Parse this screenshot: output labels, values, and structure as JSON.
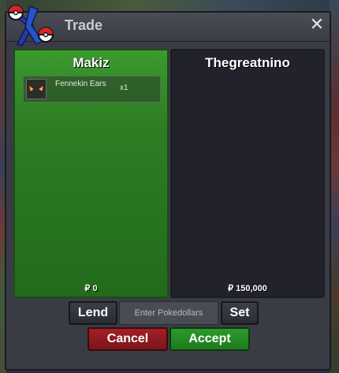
{
  "window": {
    "title": "Trade",
    "close_label": "✕"
  },
  "left_panel": {
    "player": "Makiz",
    "money": "₽ 0",
    "items": [
      {
        "name": "Fennekin Ears",
        "qty": "x1",
        "icon": "fennekin-ears-icon"
      }
    ]
  },
  "right_panel": {
    "player": "Thegreatnino",
    "money": "₽ 150,000"
  },
  "controls": {
    "lend_label": "Lend",
    "pokedollars_placeholder": "Enter Pokedollars",
    "set_label": "Set",
    "cancel_label": "Cancel",
    "accept_label": "Accept"
  },
  "colors": {
    "accent_green": "#2e7d24",
    "cancel_red": "#a31f26",
    "accept_green": "#2b9a2a",
    "window_bg": "#3a3c45",
    "right_panel_bg": "#22222c"
  }
}
